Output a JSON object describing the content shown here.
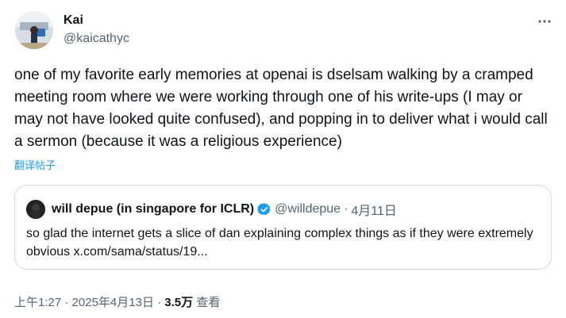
{
  "author": {
    "display_name": "Kai",
    "handle": "@kaicathyc"
  },
  "tweet": {
    "text": "one of my favorite early memories at openai is dselsam walking by a cramped meeting room where we were working through one of his write-ups (I may or may not have looked quite confused), and popping in to deliver what i would call a sermon (because it was a religious experience)",
    "translate_label": "翻译帖子"
  },
  "quote": {
    "display_name": "will depue (in singapore for ICLR)",
    "handle": "@willdepue",
    "separator": "·",
    "date": "4月11日",
    "text": "so glad the internet gets a slice of dan explaining complex things as if they were extremely obvious x.com/sama/status/19..."
  },
  "meta": {
    "time": "上午1:27",
    "separator1": "·",
    "date": "2025年4月13日",
    "separator2": "·",
    "views_count": "3.5万",
    "views_label": "查看"
  },
  "colors": {
    "accent": "#1d9bf0",
    "secondary_text": "#536471",
    "border": "#cfd9de"
  },
  "icons": {
    "more": "more-horizontal-icon",
    "verified": "verified-badge-icon"
  }
}
